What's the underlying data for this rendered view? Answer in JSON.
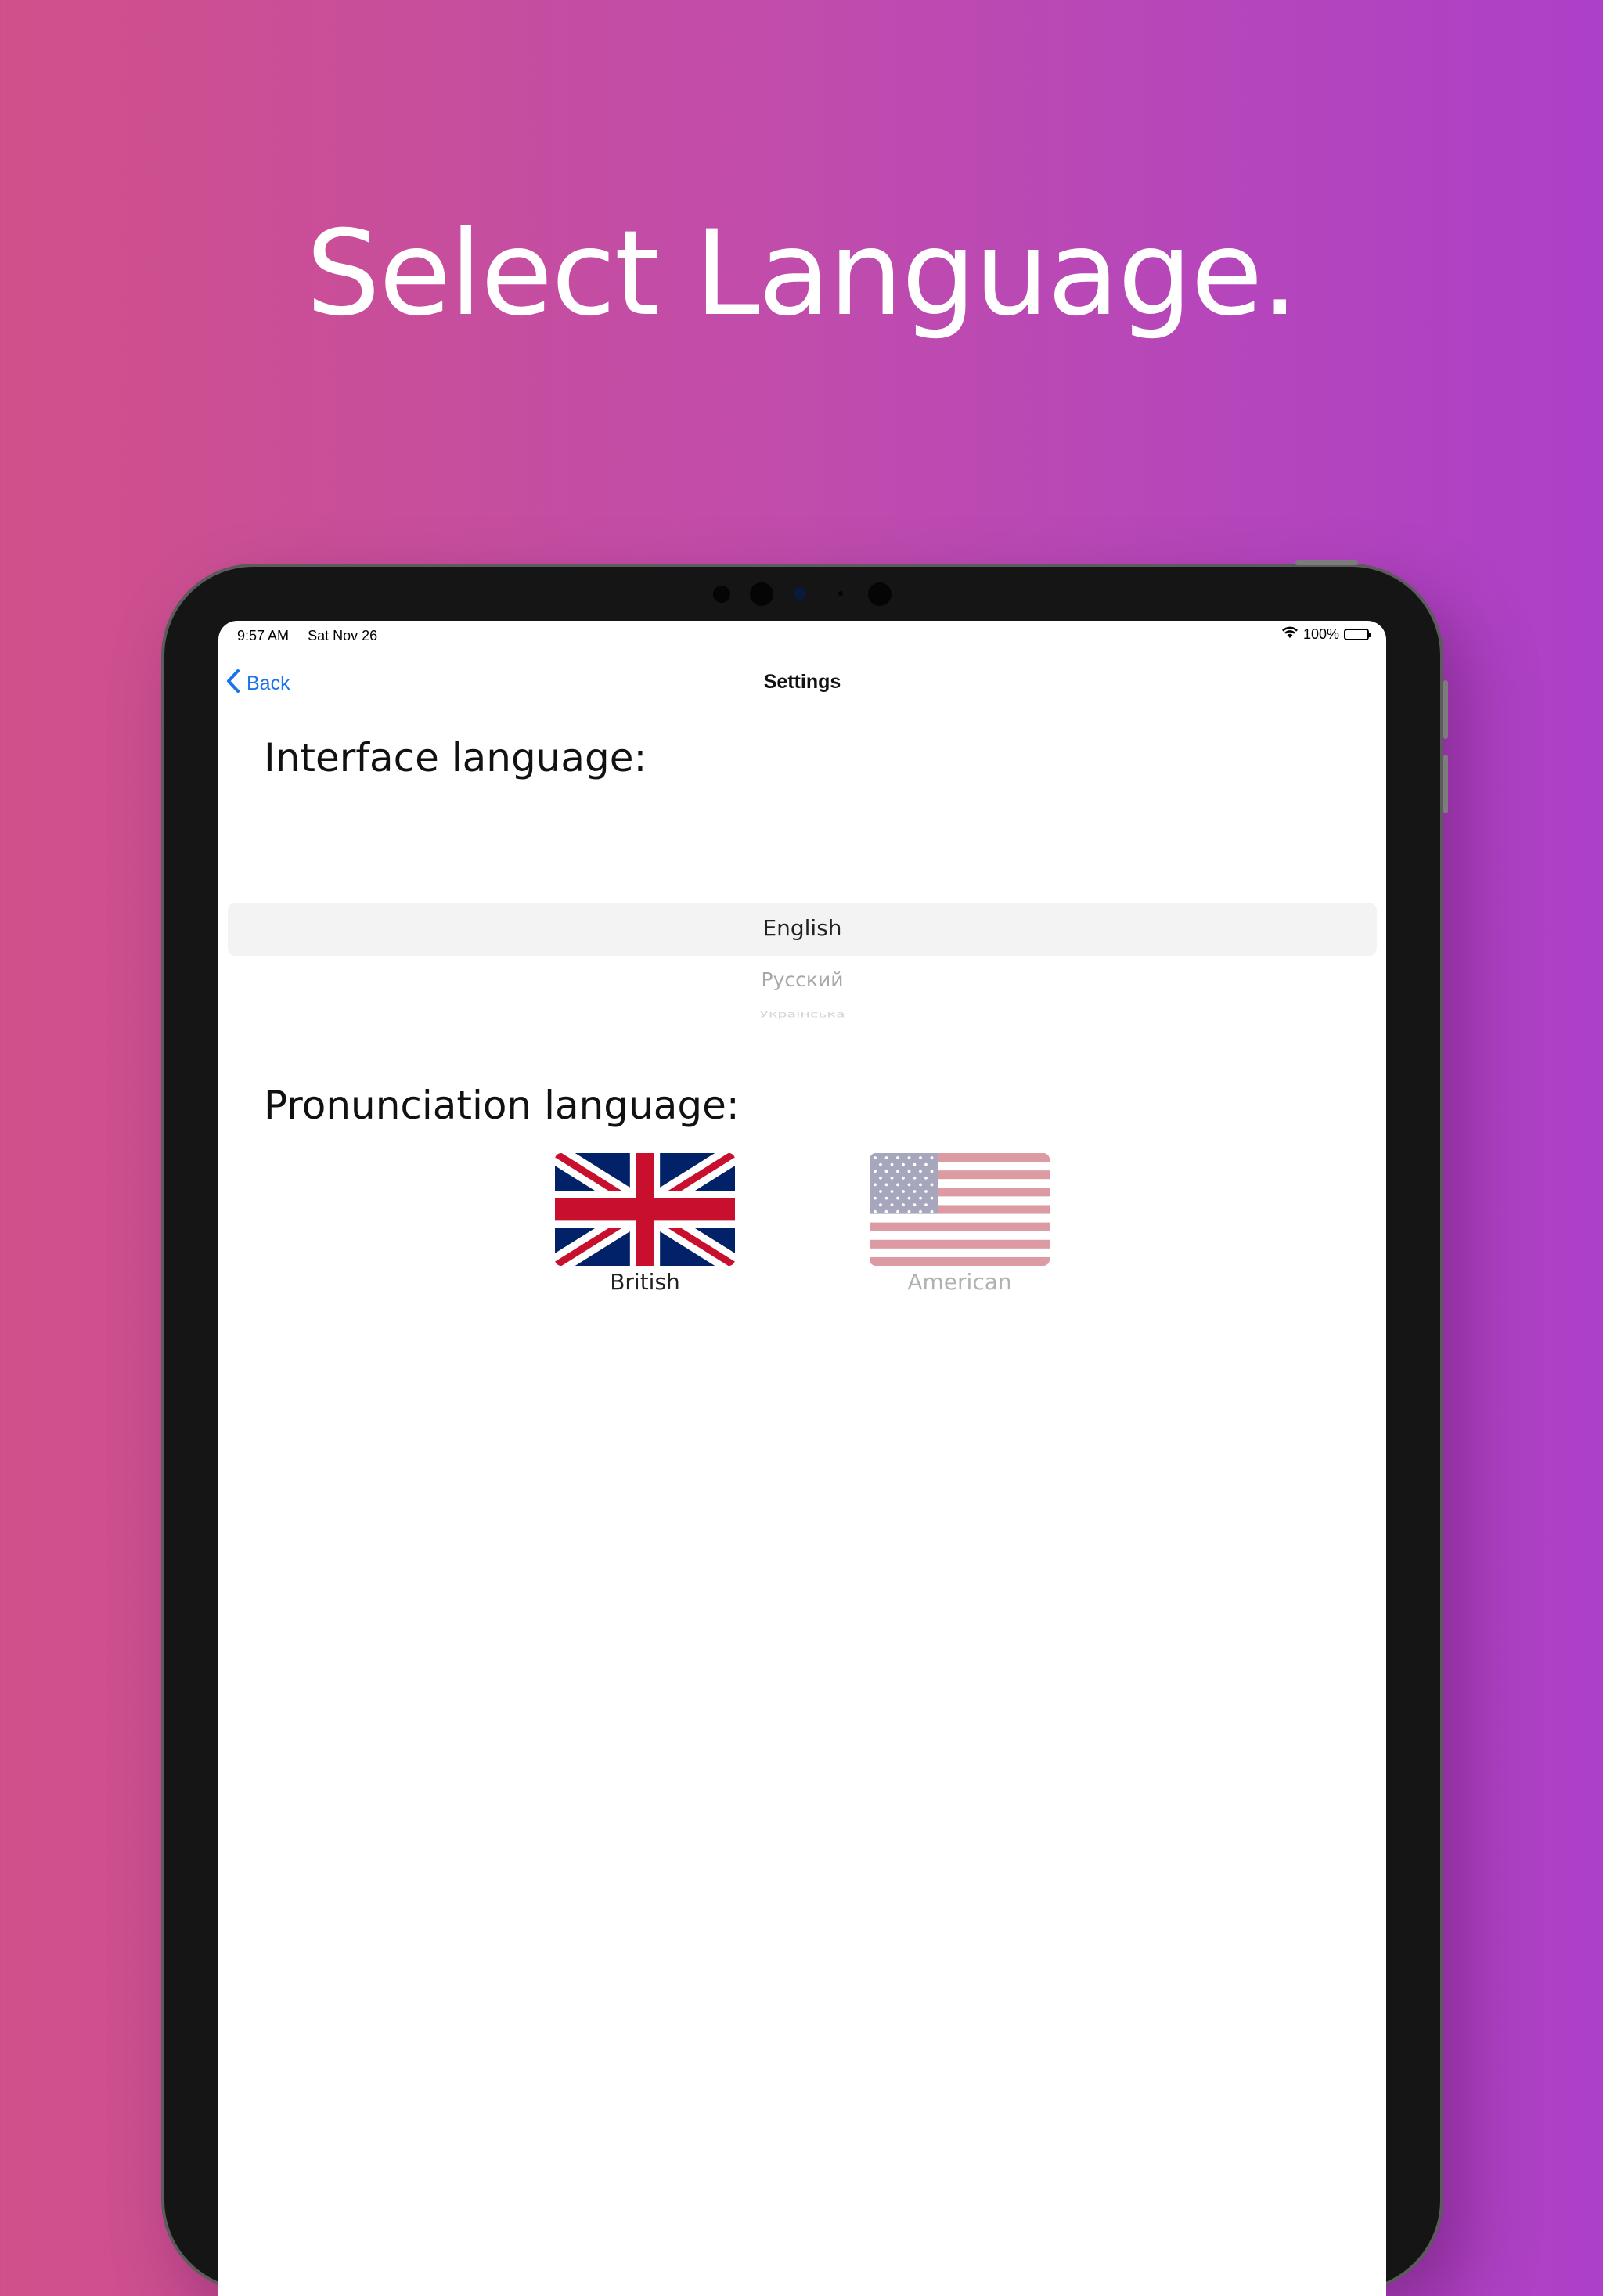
{
  "promo": {
    "headline": "Select Language."
  },
  "status_bar": {
    "time": "9:57 AM",
    "date": "Sat Nov 26",
    "battery": "100%",
    "wifi_icon": "wifi-icon",
    "battery_icon": "battery-icon"
  },
  "nav": {
    "back_label": "Back",
    "title": "Settings",
    "back_icon": "chevron-left-icon"
  },
  "interface_language": {
    "title": "Interface language:",
    "options": [
      "English",
      "Русский",
      "Українська"
    ],
    "selected": "English"
  },
  "pronunciation_language": {
    "title": "Pronunciation language:",
    "options": [
      {
        "label": "British",
        "icon": "uk-flag-icon",
        "selected": true
      },
      {
        "label": "American",
        "icon": "us-flag-icon",
        "selected": false
      }
    ]
  },
  "colors": {
    "accent": "#1a73e8",
    "gradient_start": "#d0508a",
    "gradient_end": "#ac40c8"
  }
}
